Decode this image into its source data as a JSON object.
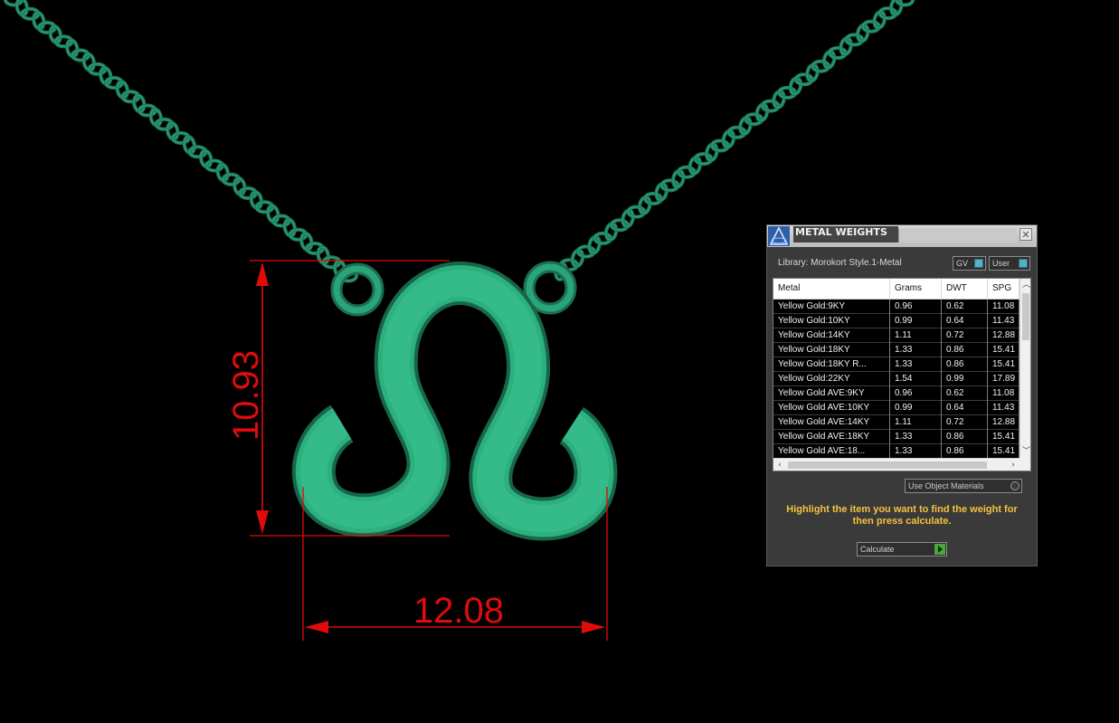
{
  "dimensions": {
    "height": "10.93",
    "width": "12.08"
  },
  "colors": {
    "pendant": "#2bb07e",
    "chain": "#1e7b5a",
    "dimension": "#e00b0b",
    "instructions": "#f6c23e"
  },
  "panel": {
    "title": "METAL WEIGHTS",
    "close_icon": "✕",
    "library": "Library: Morokort Style.1-Metal",
    "toggles": {
      "gv": "GV",
      "user": "User"
    },
    "columns": [
      "Metal",
      "Grams",
      "DWT",
      "SPG"
    ],
    "rows": [
      [
        "Yellow Gold:9KY",
        "0.96",
        "0.62",
        "11.08"
      ],
      [
        "Yellow Gold:10KY",
        "0.99",
        "0.64",
        "11.43"
      ],
      [
        "Yellow Gold:14KY",
        "1.11",
        "0.72",
        "12.88"
      ],
      [
        "Yellow Gold:18KY",
        "1.33",
        "0.86",
        "15.41"
      ],
      [
        "Yellow Gold:18KY R...",
        "1.33",
        "0.86",
        "15.41"
      ],
      [
        "Yellow Gold:22KY",
        "1.54",
        "0.99",
        "17.89"
      ],
      [
        "Yellow Gold AVE:9KY",
        "0.96",
        "0.62",
        "11.08"
      ],
      [
        "Yellow Gold AVE:10KY",
        "0.99",
        "0.64",
        "11.43"
      ],
      [
        "Yellow Gold AVE:14KY",
        "1.11",
        "0.72",
        "12.88"
      ],
      [
        "Yellow Gold AVE:18KY",
        "1.33",
        "0.86",
        "15.41"
      ],
      [
        "Yellow Gold AVE:18...",
        "1.33",
        "0.86",
        "15.41"
      ]
    ],
    "use_object_materials": "Use Object Materials",
    "instructions": "Highlight the item you want to find the weight for then press calculate.",
    "calculate": "Calculate"
  }
}
